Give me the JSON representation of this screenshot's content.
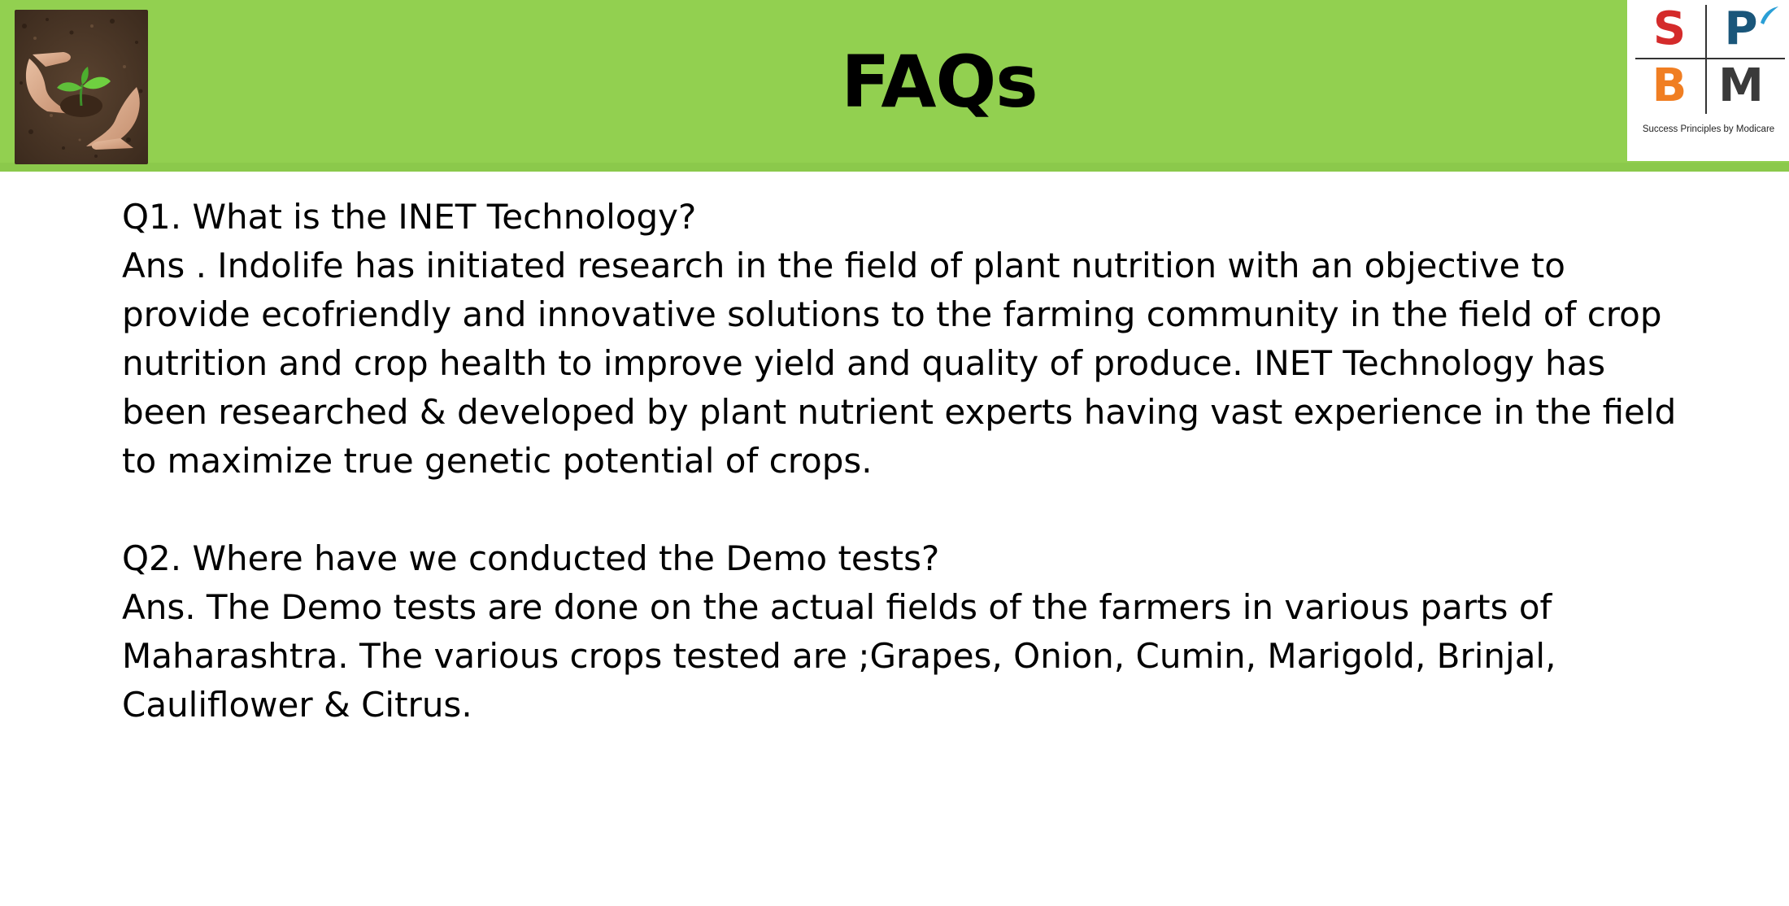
{
  "header": {
    "title": "FAQs",
    "band_color": "#92d050",
    "photo_icon": "hands-holding-seedling-photo"
  },
  "logo": {
    "letters": {
      "s": "S",
      "p": "P",
      "b": "B",
      "m": "M"
    },
    "tagline": "Success Principles by Modicare",
    "colors": {
      "s": "#d42b2b",
      "p": "#1a567a",
      "b": "#f07e22",
      "m": "#3a3a3a"
    }
  },
  "faqs": [
    {
      "question": "Q1. What is the INET Technology?",
      "answer": "Ans . Indolife has initiated research in the field of plant nutrition with an objective to provide ecofriendly and innovative solutions to the farming community in the field of crop nutrition and crop health to improve yield and quality of produce. INET Technology  has been researched & developed by plant nutrient experts having vast experience in the field to maximize true genetic potential of crops."
    },
    {
      "question": "Q2. Where have we conducted the Demo tests?",
      "answer": "Ans. The Demo tests are done on the actual fields of the farmers in various parts of Maharashtra. The various crops tested are ;Grapes, Onion, Cumin, Marigold, Brinjal, Cauliflower & Citrus."
    }
  ]
}
